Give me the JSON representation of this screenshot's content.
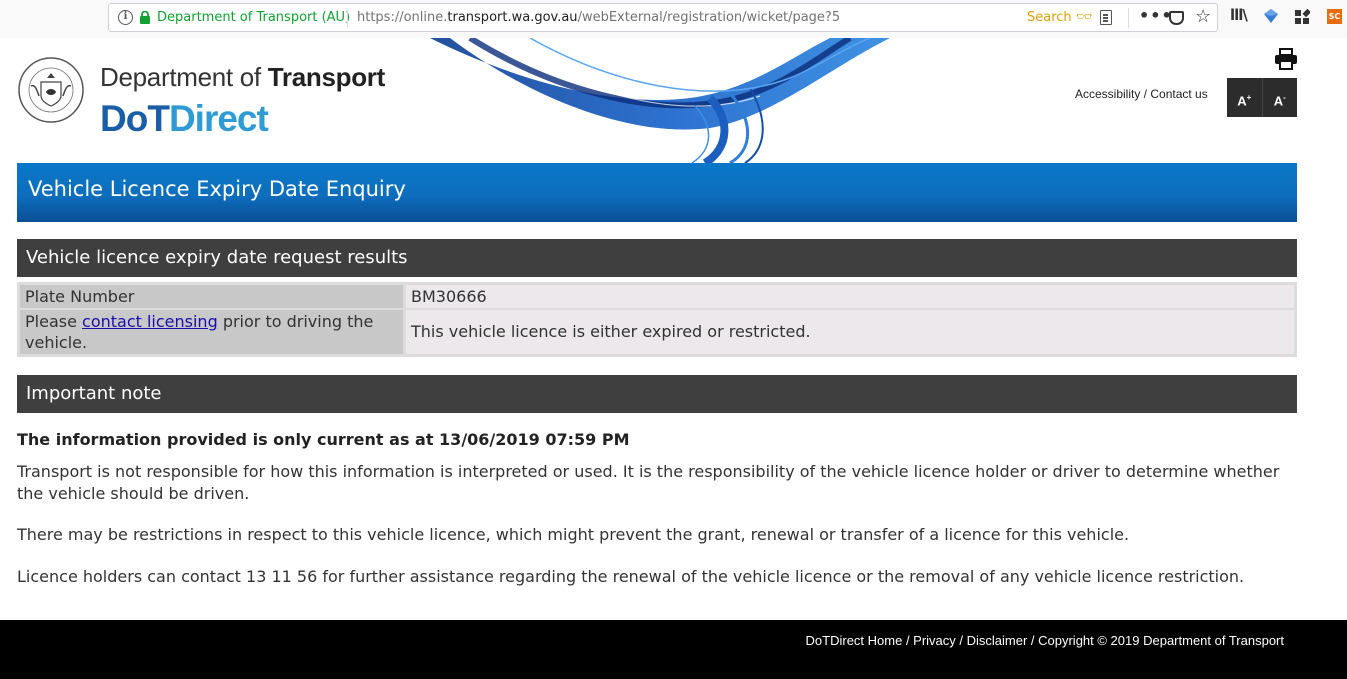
{
  "browser": {
    "site_identity": "Department of Transport (AU)",
    "url_prefix": "https://online.",
    "url_domain": "transport.wa.gov.au",
    "url_path": "/webExternal/registration/wicket/page?5",
    "search_label": "Search",
    "menu_dots": "•••",
    "star_glyph": "☆",
    "library_glyph": "lll\\",
    "ext_badge": "SC"
  },
  "header": {
    "dept_prefix": "Department of ",
    "dept_bold": "Transport",
    "brand_dot": "DoT",
    "brand_direct": "Direct",
    "accessibility_links": "Accessibility / Contact us",
    "font_increase": "A",
    "font_increase_sup": "+",
    "font_decrease": "A",
    "font_decrease_sup": "-"
  },
  "page": {
    "title": "Vehicle Licence Expiry Date Enquiry",
    "results_heading": "Vehicle licence expiry date request results",
    "results": {
      "plate_label": "Plate Number",
      "plate_value": "BM30666",
      "status_label_pre": "Please ",
      "status_label_link": "contact licensing",
      "status_label_post": " prior to driving the vehicle.",
      "status_value": "This vehicle licence is either expired or restricted."
    },
    "note_heading": "Important note",
    "note_bold": "The information provided is only current as at 13/06/2019 07:59 PM",
    "note_paragraphs": [
      "Transport is not responsible for how this information is interpreted or used. It is the responsibility of the vehicle licence holder or driver to determine whether the vehicle should be driven.",
      "There may be restrictions in respect to this vehicle licence, which might prevent the grant, renewal or transfer of a licence for this vehicle.",
      "Licence holders can contact 13 11 56 for further assistance regarding the renewal of the vehicle licence or the removal of any vehicle licence restriction."
    ]
  },
  "footer": {
    "links": "DoTDirect Home / Privacy / Disclaimer / Copyright © 2019 Department of Transport"
  },
  "colors": {
    "title_bar": "#0d6ebd",
    "section_head": "#3f3f3f",
    "brand_dark": "#1b5ea8",
    "brand_light": "#2f9bd5",
    "secure_green": "#12a131",
    "footer": "#000000"
  }
}
